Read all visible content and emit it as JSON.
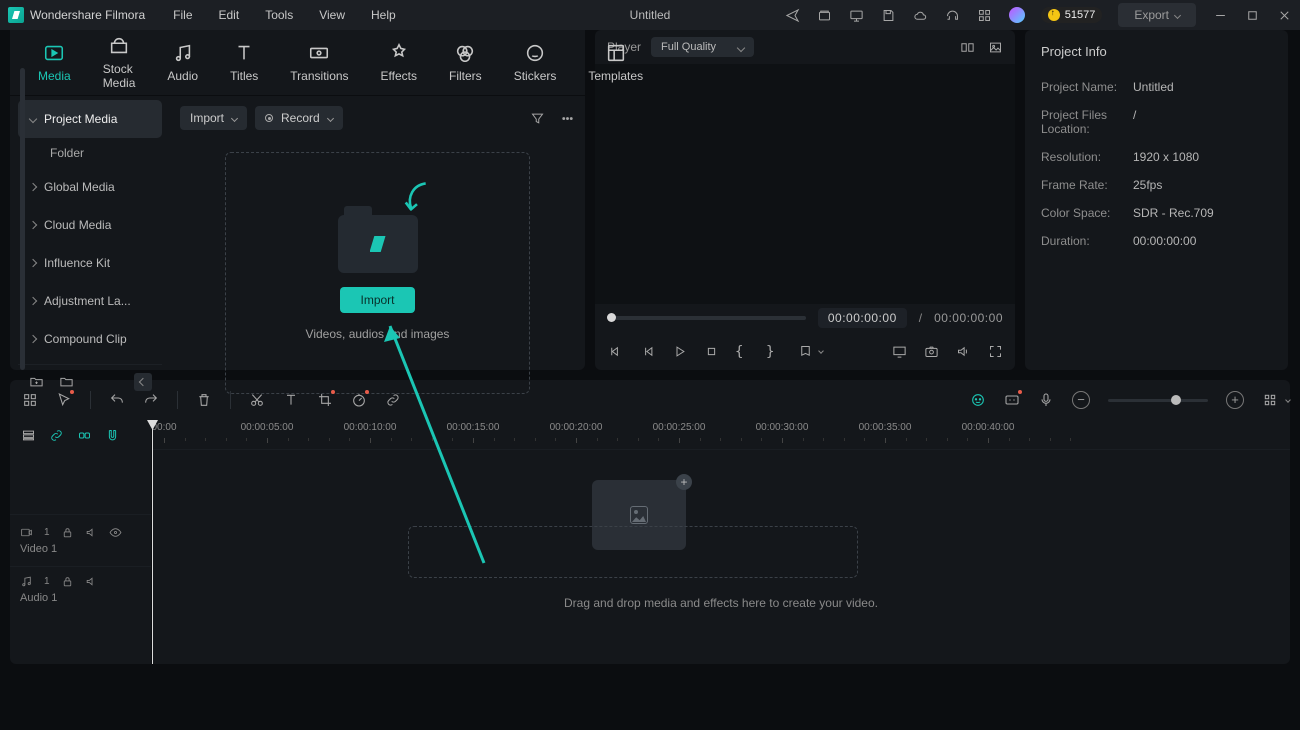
{
  "app": {
    "name": "Wondershare Filmora",
    "docTitle": "Untitled"
  },
  "menu": [
    "File",
    "Edit",
    "Tools",
    "View",
    "Help"
  ],
  "points": "51577",
  "exportLabel": "Export",
  "tabs": [
    {
      "id": "media",
      "label": "Media"
    },
    {
      "id": "stock",
      "label": "Stock Media"
    },
    {
      "id": "audio",
      "label": "Audio"
    },
    {
      "id": "titles",
      "label": "Titles"
    },
    {
      "id": "transitions",
      "label": "Transitions"
    },
    {
      "id": "effects",
      "label": "Effects"
    },
    {
      "id": "filters",
      "label": "Filters"
    },
    {
      "id": "stickers",
      "label": "Stickers"
    },
    {
      "id": "templates",
      "label": "Templates"
    }
  ],
  "sidebar": {
    "items": [
      "Project Media",
      "Global Media",
      "Cloud Media",
      "Influence Kit",
      "Adjustment La...",
      "Compound Clip"
    ],
    "folder": "Folder"
  },
  "mediaToolbar": {
    "import": "Import",
    "record": "Record"
  },
  "dropzone": {
    "button": "Import",
    "caption": "Videos, audios and images"
  },
  "player": {
    "label": "Player",
    "quality": "Full Quality",
    "cur": "00:00:00:00",
    "dur": "00:00:00:00"
  },
  "info": {
    "title": "Project Info",
    "rows": [
      {
        "k": "Project Name:",
        "v": "Untitled"
      },
      {
        "k": "Project Files Location:",
        "v": "/"
      },
      {
        "k": "Resolution:",
        "v": "1920 x 1080"
      },
      {
        "k": "Frame Rate:",
        "v": "25fps"
      },
      {
        "k": "Color Space:",
        "v": "SDR - Rec.709"
      },
      {
        "k": "Duration:",
        "v": "00:00:00:00"
      }
    ]
  },
  "timeline": {
    "marks": [
      "00:00",
      "00:00:05:00",
      "00:00:10:00",
      "00:00:15:00",
      "00:00:20:00",
      "00:00:25:00",
      "00:00:30:00",
      "00:00:35:00",
      "00:00:40:00"
    ],
    "video": "Video 1",
    "audio": "Audio 1",
    "hint": "Drag and drop media and effects here to create your video."
  }
}
